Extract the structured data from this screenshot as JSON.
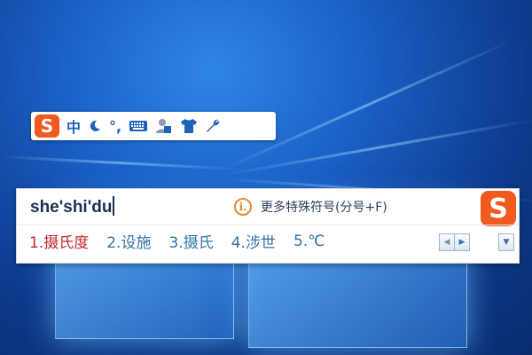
{
  "status_bar": {
    "logo_letter": "S",
    "mode_label": "中",
    "icons": [
      "moon-icon",
      "punctuation-icon",
      "keyboard-icon",
      "user-icon",
      "shirt-icon",
      "wrench-icon"
    ],
    "punctuation_glyph": "°,"
  },
  "candidate_window": {
    "pinyin": "she'shi'du",
    "hint": {
      "icon_glyph": "i.",
      "text": "更多特殊符号(分号+F)"
    },
    "logo_letter": "S",
    "candidates": [
      {
        "index": "1.",
        "text": "摄氏度"
      },
      {
        "index": "2.",
        "text": "设施"
      },
      {
        "index": "3.",
        "text": "摄氏"
      },
      {
        "index": "4.",
        "text": "涉世"
      },
      {
        "index": "5.",
        "text": "℃"
      }
    ],
    "nav": {
      "prev": "◀",
      "next": "▶",
      "menu": "▼"
    }
  },
  "colors": {
    "brand": "#f05a1e",
    "first_candidate": "#c0262c",
    "candidate": "#3272a8",
    "wallpaper": "#1a5fc4"
  }
}
